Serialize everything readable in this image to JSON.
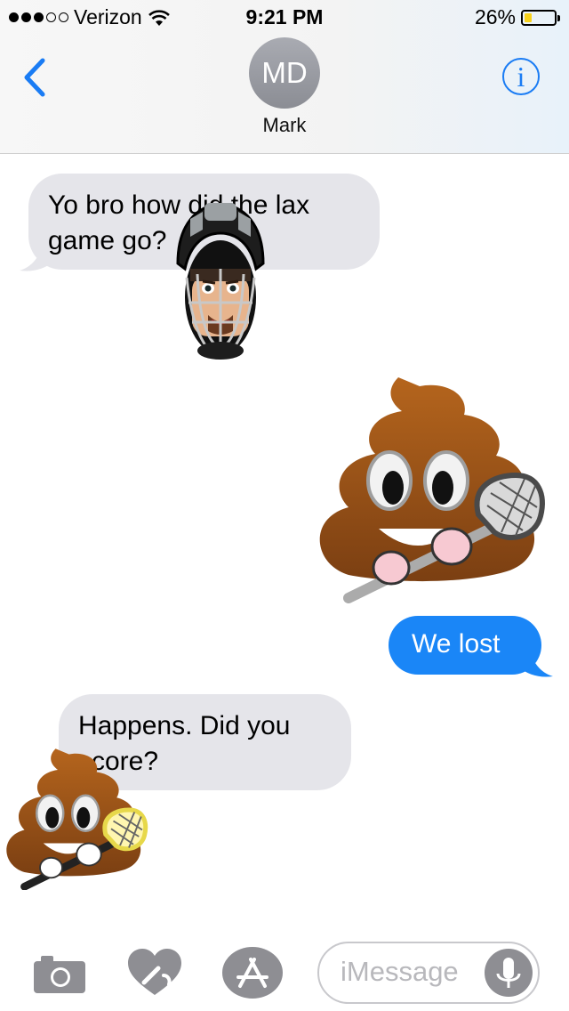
{
  "status_bar": {
    "carrier": "Verizon",
    "signal_bars_filled": 3,
    "signal_bars_total": 5,
    "time": "9:21 PM",
    "battery_percent": "26%",
    "battery_level": 0.26,
    "battery_color": "#f8d21b"
  },
  "header": {
    "avatar_initials": "MD",
    "contact_name": "Mark",
    "back_icon": "chevron-left-icon",
    "info_icon": "info-icon",
    "info_glyph": "i",
    "accent_color": "#1a7cf4"
  },
  "messages": [
    {
      "direction": "incoming",
      "text": "Yo bro how did the lax game go?"
    },
    {
      "direction": "incoming",
      "type": "sticker",
      "sticker": "lacrosse-goalie-helmet-sticker"
    },
    {
      "direction": "outgoing",
      "type": "sticker",
      "sticker": "poop-with-lacrosse-stick-sticker"
    },
    {
      "direction": "outgoing",
      "text": "We lost"
    },
    {
      "direction": "incoming",
      "text": "Happens. Did you score?"
    },
    {
      "direction": "incoming",
      "type": "sticker",
      "sticker": "poop-with-lacrosse-stick-sticker"
    }
  ],
  "compose_bar": {
    "camera_icon": "camera-icon",
    "digital_touch_icon": "digital-touch-heart-icon",
    "app_store_icon": "app-store-icon",
    "placeholder": "iMessage",
    "mic_icon": "microphone-icon"
  },
  "colors": {
    "incoming_bubble": "#e5e5ea",
    "outgoing_bubble": "#1a86f7"
  }
}
